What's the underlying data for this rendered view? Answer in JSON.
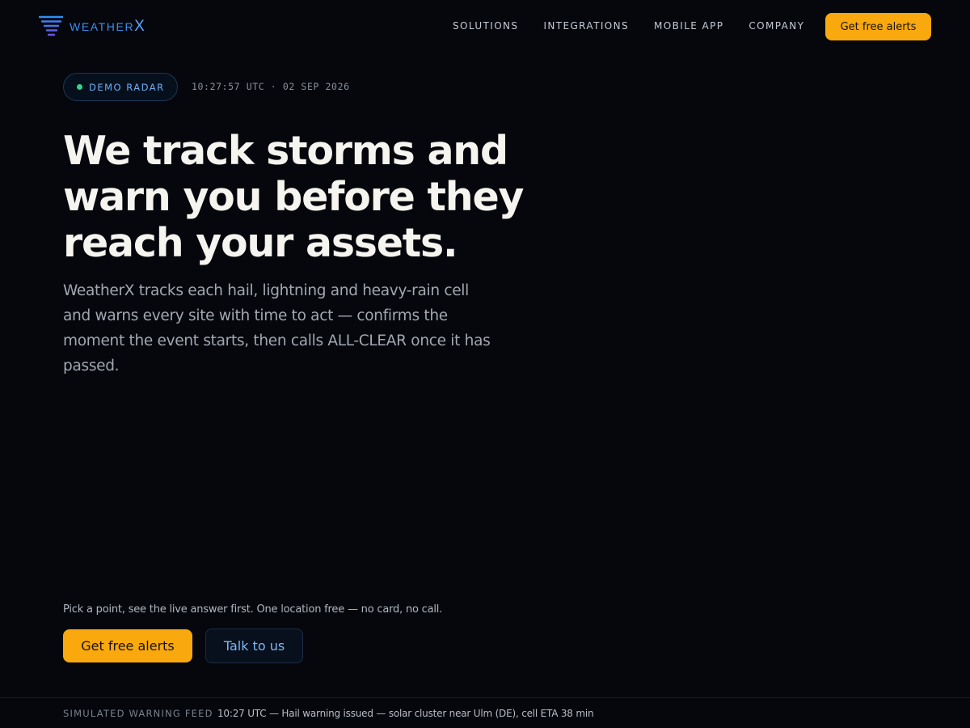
{
  "brand": {
    "name_prefix": "WEATHER",
    "name_suffix": "X",
    "logo_icon": "wind-lines-icon",
    "accent": "#3b8ff0"
  },
  "nav": {
    "items": [
      {
        "label": "SOLUTIONS"
      },
      {
        "label": "INTEGRATIONS"
      },
      {
        "label": "MOBILE APP"
      },
      {
        "label": "COMPANY"
      }
    ],
    "cta_label": "Get free alerts"
  },
  "badge": {
    "label": "DEMO RADAR",
    "status_color": "#37d38a"
  },
  "timestamp": "10:27:57 UTC · 02 SEP 2026",
  "hero": {
    "headline": "We track storms and warn you before they reach your assets.",
    "subtext": "WeatherX tracks each hail, lightning and heavy-rain cell and warns every site with time to act — confirms the moment the event starts, then calls ALL-CLEAR once it has passed."
  },
  "cta": {
    "note": "Pick a point, see the live answer first. One location free — no card, no call.",
    "primary_label": "Get free alerts",
    "secondary_label": "Talk to us",
    "primary_color": "#f9a80d"
  },
  "feed": {
    "label": "SIMULATED WARNING FEED",
    "message": "10:27 UTC — Hail warning issued — solar cluster near Ulm (DE), cell ETA 38 min"
  }
}
